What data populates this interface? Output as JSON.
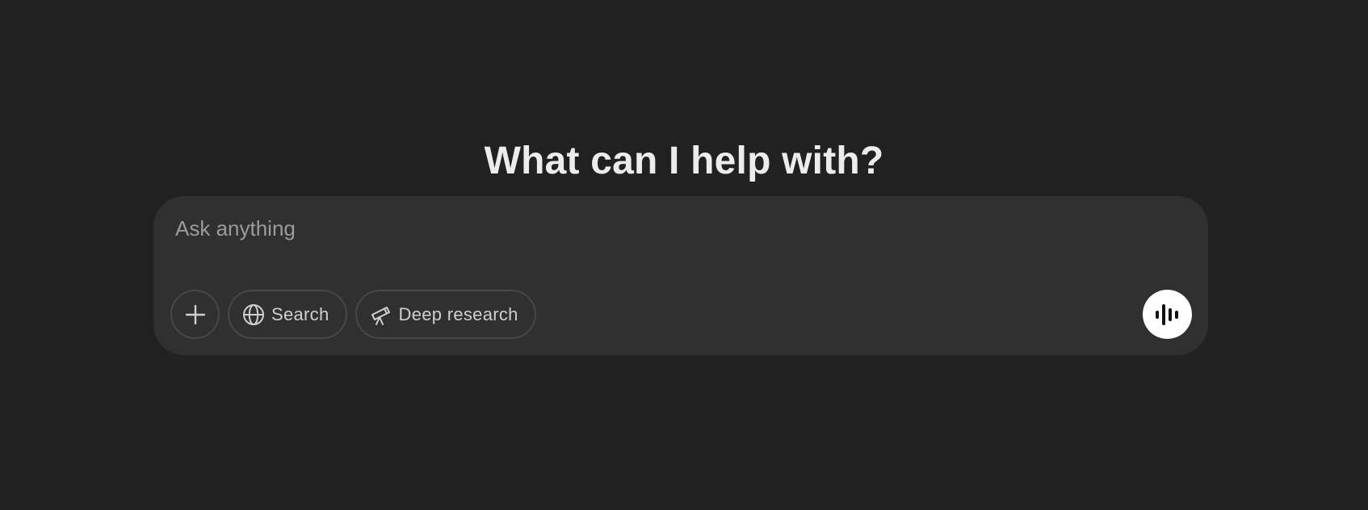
{
  "heading": "What can I help with?",
  "composer": {
    "placeholder": "Ask anything",
    "value": ""
  },
  "toolbar": {
    "add_icon": "plus-icon",
    "search": {
      "icon": "globe-icon",
      "label": "Search"
    },
    "deep_research": {
      "icon": "telescope-icon",
      "label": "Deep research"
    },
    "voice_icon": "voice-waveform-icon"
  },
  "colors": {
    "background": "#212121",
    "composer": "#303030",
    "border": "#474747",
    "heading_text": "#ececec",
    "placeholder_text": "#9b9b9b",
    "voice_button": "#ffffff"
  }
}
